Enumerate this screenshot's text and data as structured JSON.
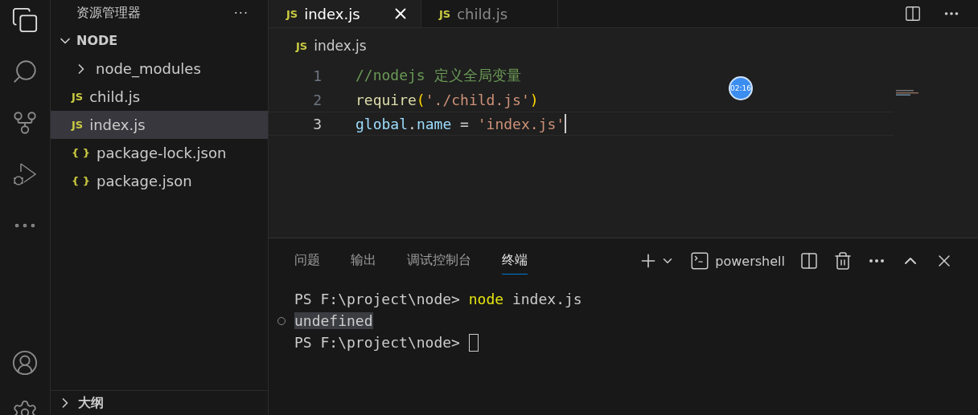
{
  "activity_bar": {
    "items": [
      {
        "kind": "files",
        "selected": true
      },
      {
        "kind": "search",
        "selected": false
      },
      {
        "kind": "source",
        "selected": false
      },
      {
        "kind": "debug",
        "selected": false
      },
      {
        "kind": "more",
        "selected": false
      }
    ],
    "bottom_items": [
      {
        "kind": "account"
      },
      {
        "kind": "settings"
      }
    ]
  },
  "sidebar": {
    "title": "资源管理器",
    "more": "···",
    "root": {
      "label": "NODE",
      "expanded": true,
      "children": [
        {
          "label": "node_modules",
          "kind": "folder",
          "expanded": false,
          "selected": false
        },
        {
          "label": "child.js",
          "kind": "js",
          "icon": "JS",
          "selected": false
        },
        {
          "label": "index.js",
          "kind": "js",
          "icon": "JS",
          "selected": true
        },
        {
          "label": "package-lock.json",
          "kind": "json",
          "icon": "{ }",
          "selected": false
        },
        {
          "label": "package.json",
          "kind": "json",
          "icon": "{ }",
          "selected": false
        }
      ]
    },
    "outline": {
      "label": "大纲",
      "expanded": false
    }
  },
  "editor": {
    "tabs": [
      {
        "label": "index.js",
        "kind": "js",
        "icon": "JS",
        "selected": true
      },
      {
        "label": "child.js",
        "kind": "js",
        "icon": "JS",
        "selected": false
      }
    ],
    "breadcrumb": {
      "label": "index.js",
      "kind": "js",
      "icon": "JS"
    },
    "timer_badge": "02:16",
    "lines": [
      {
        "number": "1",
        "current": false,
        "tokens": [
          {
            "text": "//nodejs 定义全局变量",
            "kind": "comment"
          }
        ]
      },
      {
        "number": "2",
        "current": false,
        "tokens": [
          {
            "text": "require",
            "kind": "function"
          },
          {
            "text": "(",
            "kind": "paren"
          },
          {
            "text": "'./child.js'",
            "kind": "string"
          },
          {
            "text": ")",
            "kind": "paren"
          }
        ]
      },
      {
        "number": "3",
        "current": true,
        "tokens": [
          {
            "text": "global",
            "kind": "variable"
          },
          {
            "text": ".",
            "kind": "plain"
          },
          {
            "text": "name",
            "kind": "variable"
          },
          {
            "text": " = ",
            "kind": "plain"
          },
          {
            "text": "'index.js'",
            "kind": "string"
          }
        ]
      }
    ]
  },
  "panel": {
    "tabs": [
      {
        "label": "问题",
        "selected": false
      },
      {
        "label": "输出",
        "selected": false
      },
      {
        "label": "调试控制台",
        "selected": false
      },
      {
        "label": "终端",
        "selected": true
      }
    ],
    "shell": "powershell",
    "terminal": [
      {
        "marker": false,
        "cursor": false,
        "segments": [
          {
            "text": "PS F:\\project\\node> ",
            "kind": "plain"
          },
          {
            "text": "node",
            "kind": "command"
          },
          {
            "text": " index.js",
            "kind": "plain"
          }
        ]
      },
      {
        "marker": true,
        "cursor": false,
        "segments": [
          {
            "text": "undefined",
            "kind": "highlight"
          }
        ]
      },
      {
        "marker": false,
        "cursor": true,
        "segments": [
          {
            "text": "PS F:\\project\\node> ",
            "kind": "plain"
          }
        ]
      }
    ]
  }
}
